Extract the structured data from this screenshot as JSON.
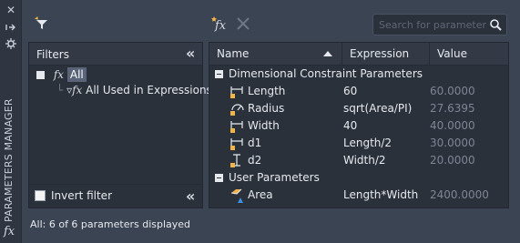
{
  "palette": "PARAMETERS MANAGER",
  "search": {
    "placeholder": "Search for parameter"
  },
  "filters": {
    "title": "Filters",
    "tree": [
      {
        "label": "All",
        "selected": true
      },
      {
        "label": "All Used in Expressions"
      }
    ],
    "invert_label": "Invert filter",
    "invert_checked": false
  },
  "table": {
    "columns": [
      "Name",
      "Expression",
      "Value"
    ],
    "groups": [
      {
        "label": "Dimensional Constraint Parameters",
        "rows": [
          {
            "icon": "linear-dimension-lock-icon",
            "name": "Length",
            "expression": "60",
            "value": "60.0000"
          },
          {
            "icon": "radial-dimension-lock-icon",
            "name": "Radius",
            "expression": "sqrt(Area/PI)",
            "value": "27.6395"
          },
          {
            "icon": "linear-dimension-lock-icon",
            "name": "Width",
            "expression": "40",
            "value": "40.0000"
          },
          {
            "icon": "linear-dimension-lock-icon",
            "name": "d1",
            "expression": "Length/2",
            "value": "30.0000"
          },
          {
            "icon": "vertical-dimension-lock-icon",
            "name": "d2",
            "expression": "Width/2",
            "value": "20.0000"
          }
        ]
      },
      {
        "label": "User Parameters",
        "rows": [
          {
            "icon": "user-parameter-icon",
            "name": "Area",
            "expression": "Length*Width",
            "value": "2400.0000"
          }
        ]
      }
    ]
  },
  "status": "All: 6 of 6 parameters displayed",
  "colors": {
    "accent": "#f0b54a",
    "background": "#3b4453",
    "panel": "#2b313b"
  }
}
